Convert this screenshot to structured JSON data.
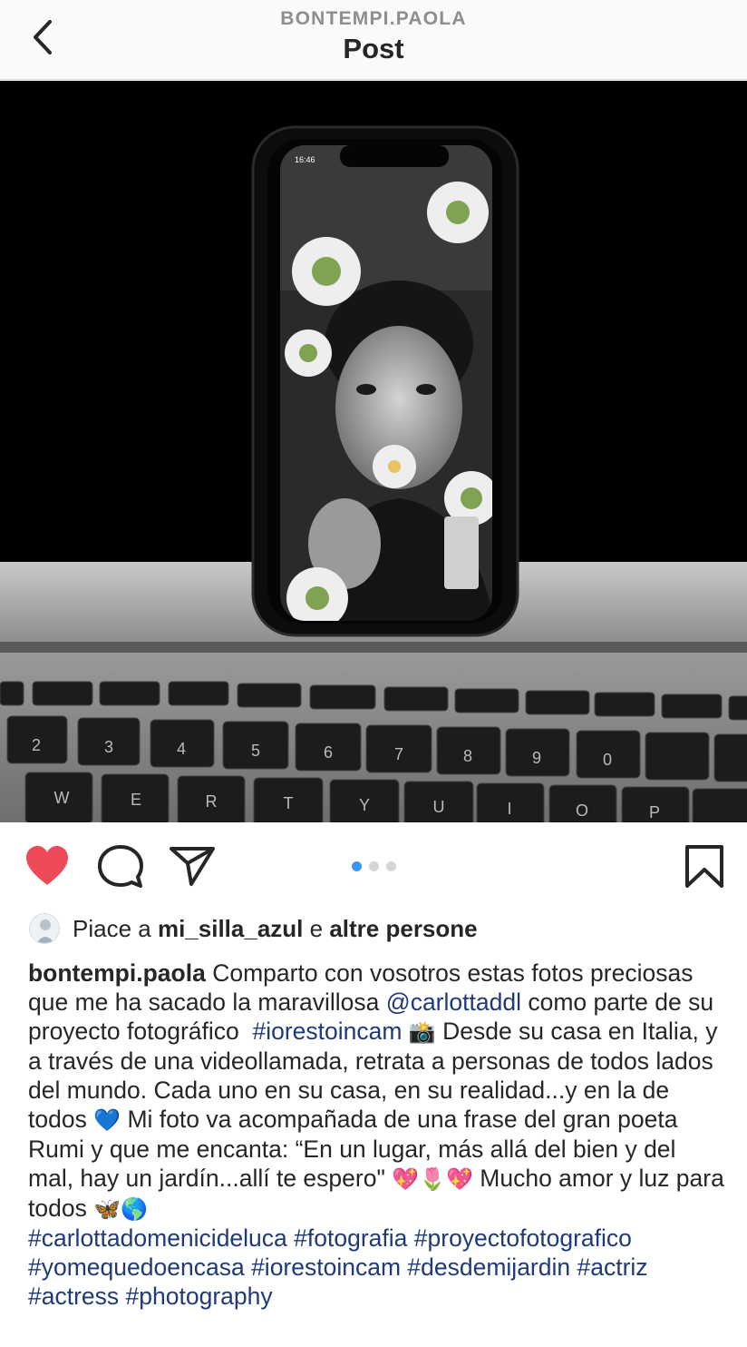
{
  "header": {
    "username": "BONTEMPI.PAOLA",
    "title": "Post"
  },
  "icons": {
    "back": "chevron-left-icon",
    "like": "heart-filled-icon",
    "comment": "comment-bubble-icon",
    "share": "paper-plane-icon",
    "save": "bookmark-icon"
  },
  "colors": {
    "like": "#ed4956",
    "link": "#1e3a78",
    "active_dot": "#3897f0"
  },
  "carousel": {
    "total": 3,
    "active": 1
  },
  "likes": {
    "prefix": "Piace a",
    "user": "mi_silla_azul",
    "connector": "e",
    "others": "altre persone"
  },
  "caption": {
    "username": "bontempi.paola",
    "part1": "Comparto con vosotros estas fotos preciosas que me ha sacado la maravillosa",
    "mention": "@carlottaddl",
    "part2": "como parte de su proyecto fotográfico",
    "tag1": "#iorestoincam",
    "emoji_camera": "📸",
    "part3": "Desde su casa en Italia, y a través de una videollamada, retrata a personas de todos lados del mundo. Cada uno en su casa, en su realidad...y en la de todos",
    "emoji_heart": "💙",
    "part4": "Mi foto va acompañada de una frase del gran poeta Rumi y que me encanta: “En un lugar, más allá del bien y del mal, hay un jardín...allí te espero\"",
    "emoji_set1": "💖🌷💖",
    "part5": "Mucho amor y luz para todos",
    "emoji_set2": "🦋🌎",
    "hashtags": [
      "#carlottadomenicideluca",
      "#fotografia",
      "#proyectofotografico",
      "#yomequedoencasa",
      "#iorestoincam",
      "#desdemijardin",
      "#actriz",
      "#actress",
      "#photography"
    ]
  }
}
